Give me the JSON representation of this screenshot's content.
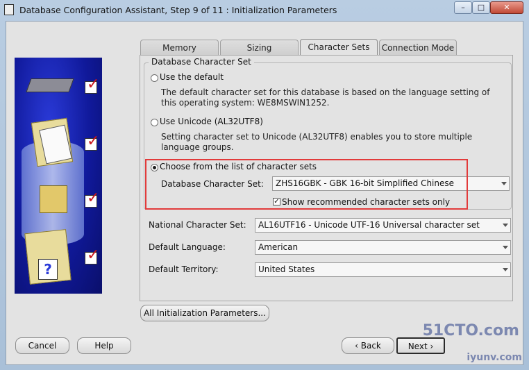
{
  "window": {
    "title": "Database Configuration Assistant, Step 9 of 11 : Initialization Parameters",
    "min_label": "–",
    "max_label": "□",
    "close_label": "✕"
  },
  "tabs": [
    {
      "label": "Memory"
    },
    {
      "label": "Sizing"
    },
    {
      "label": "Character Sets"
    },
    {
      "label": "Connection Mode"
    }
  ],
  "charset_group": {
    "legend": "Database Character Set",
    "option_default": {
      "label": "Use the default",
      "desc": "The default character set for this database is based on the language setting of this operating system: WE8MSWIN1252."
    },
    "option_unicode": {
      "label": "Use Unicode (AL32UTF8)",
      "desc": "Setting character set to Unicode (AL32UTF8) enables you to store multiple language groups."
    },
    "option_list": {
      "label": "Choose from the list of character sets"
    },
    "db_charset_label": "Database Character Set:",
    "db_charset_value": "ZHS16GBK - GBK 16-bit Simplified Chinese",
    "show_recommended_label": "Show recommended character sets only",
    "show_recommended_checked": "✓"
  },
  "fields": {
    "national_label": "National Character Set:",
    "national_value": "AL16UTF16 - Unicode UTF-16 Universal character set",
    "language_label": "Default Language:",
    "language_value": "American",
    "territory_label": "Default Territory:",
    "territory_value": "United States"
  },
  "buttons": {
    "all_params": "All Initialization Parameters...",
    "cancel": "Cancel",
    "help": "Help",
    "back": "Back",
    "next": "Next"
  },
  "watermark": {
    "line1": "51CTO.com",
    "line2": "iyunv.com"
  }
}
